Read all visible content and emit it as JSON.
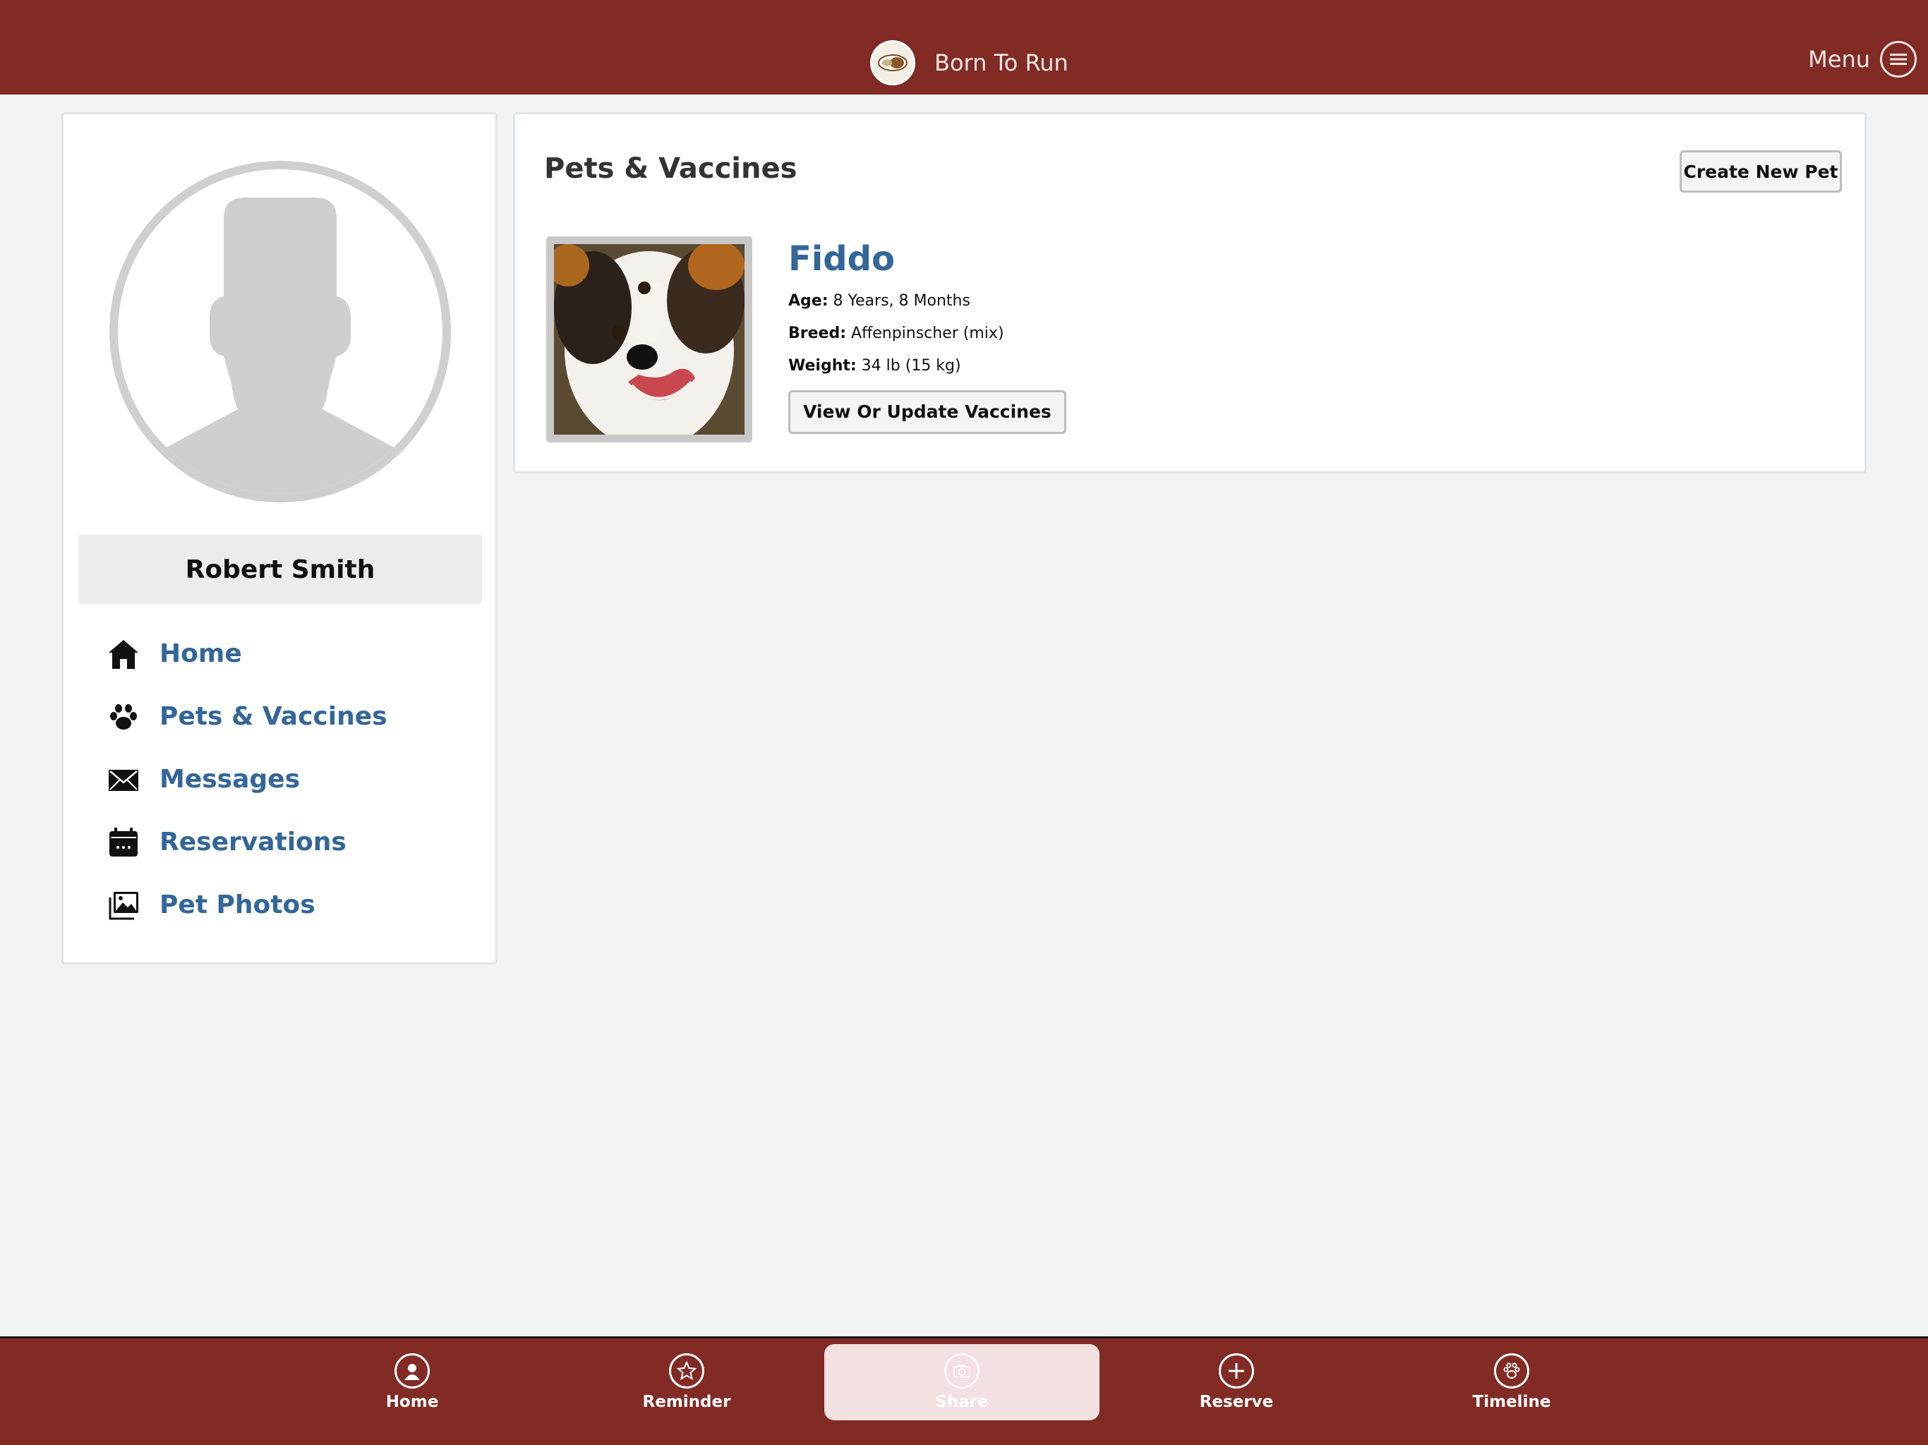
{
  "header": {
    "brand_title": "Born To Run",
    "menu_label": "Menu"
  },
  "profile": {
    "name": "Robert Smith"
  },
  "side_nav": [
    {
      "label": "Home",
      "icon": "home-icon"
    },
    {
      "label": "Pets & Vaccines",
      "icon": "paw-icon"
    },
    {
      "label": "Messages",
      "icon": "envelope-icon"
    },
    {
      "label": "Reservations",
      "icon": "calendar-icon"
    },
    {
      "label": "Pet Photos",
      "icon": "photos-icon"
    }
  ],
  "pets_section": {
    "title": "Pets & Vaccines",
    "create_button": "Create New Pet",
    "pet": {
      "name": "Fiddo",
      "age_label": "Age:",
      "age": "8 Years, 8 Months",
      "breed_label": "Breed:",
      "breed": "Affenpinscher (mix)",
      "weight_label": "Weight:",
      "weight": "34 lb (15 kg)",
      "vaccines_button": "View Or Update Vaccines"
    }
  },
  "bottom_tabs": [
    {
      "label": "Home",
      "icon": "user-circle-icon",
      "active": false
    },
    {
      "label": "Reminder",
      "icon": "star-icon",
      "active": false
    },
    {
      "label": "Share",
      "icon": "camera-icon",
      "active": true
    },
    {
      "label": "Reserve",
      "icon": "plus-icon",
      "active": false
    },
    {
      "label": "Timeline",
      "icon": "paw-icon",
      "active": false
    }
  ],
  "colors": {
    "brand": "#822a24",
    "link": "#336699",
    "background": "#f0f4f7",
    "active_tab": "#f3e0e1"
  }
}
